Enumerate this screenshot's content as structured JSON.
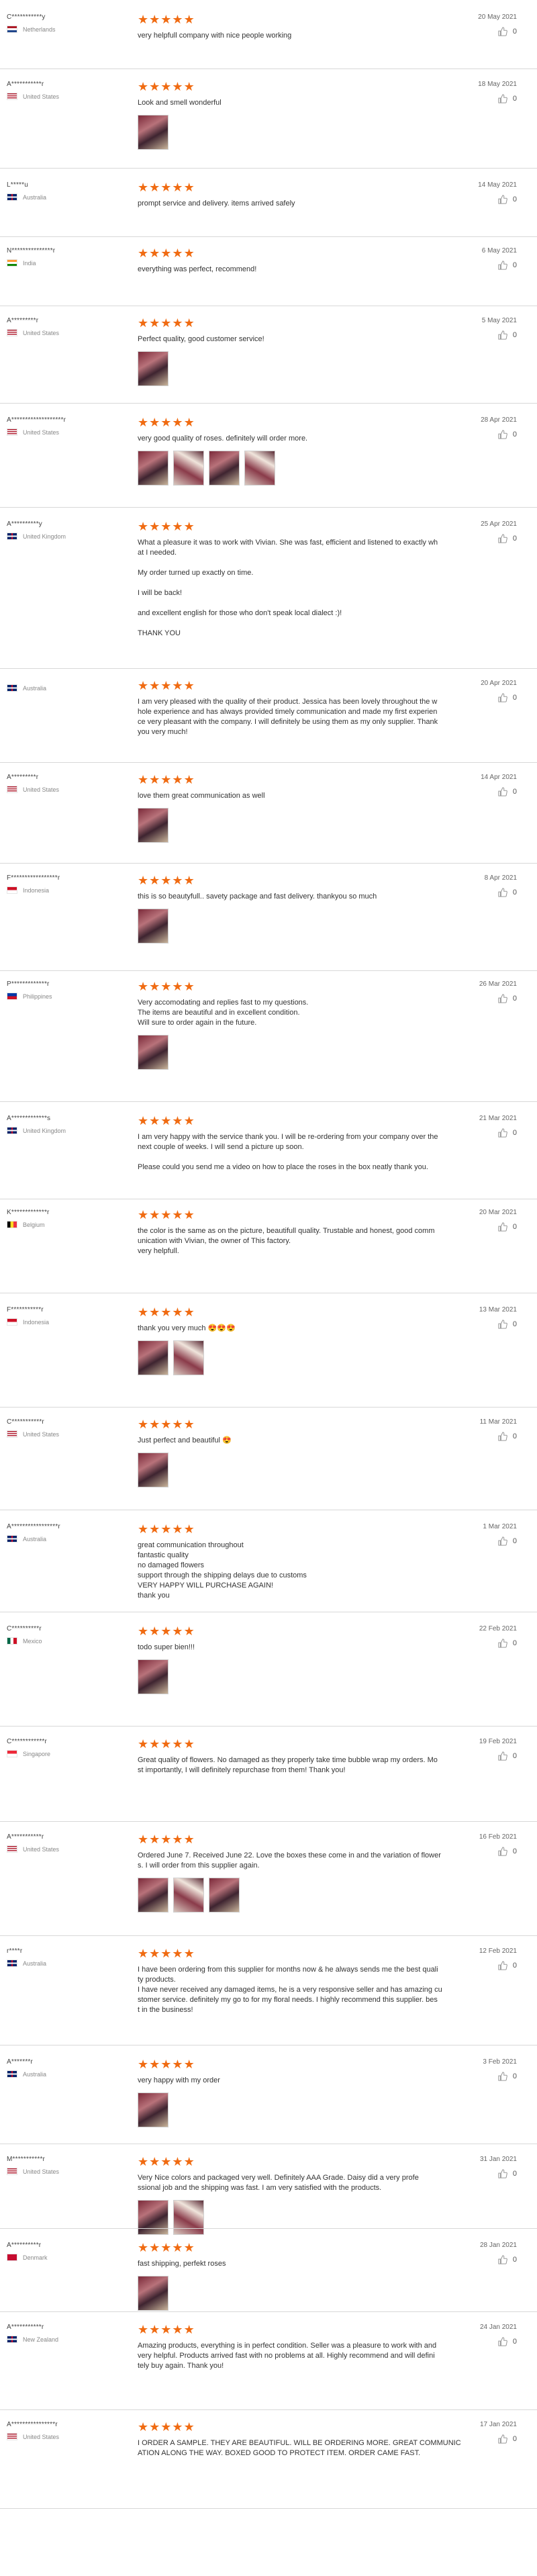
{
  "colors": {
    "star": "#f06b12",
    "divider": "#d8d8d8"
  },
  "icons": {
    "star": "star-icon",
    "useful": "thumbs-up-icon"
  },
  "reviews": [
    {
      "buyer": "C***********y",
      "country": "Netherlands",
      "flag": "nl",
      "date": "20 May 2021",
      "text": "very helpfull company with nice people working",
      "photos": 0,
      "useful": "0"
    },
    {
      "buyer": "A***********r",
      "country": "United States",
      "flag": "us",
      "date": "18 May 2021",
      "text": "Look and smell wonderful",
      "photos": 1,
      "useful": "0"
    },
    {
      "buyer": "L*****u",
      "country": "Australia",
      "flag": "au",
      "date": "14 May 2021",
      "text": "prompt service and delivery. items arrived safely",
      "photos": 0,
      "useful": "0"
    },
    {
      "buyer": "N***************r",
      "country": "India",
      "flag": "in",
      "date": "6 May 2021",
      "text": "everything was perfect, recommend!",
      "photos": 0,
      "useful": "0"
    },
    {
      "buyer": "A*********r",
      "country": "United States",
      "flag": "us",
      "date": "5 May 2021",
      "text": "Perfect quality, good customer service!",
      "photos": 1,
      "useful": "0"
    },
    {
      "buyer": "A*******************r",
      "country": "United States",
      "flag": "us",
      "date": "28 Apr 2021",
      "text": "very good quality of roses. definitely will order more.",
      "photos": 4,
      "useful": "0"
    },
    {
      "buyer": "A**********y",
      "country": "United Kingdom",
      "flag": "gb",
      "date": "25 Apr 2021",
      "text": "What a pleasure it was to work with Vivian. She was fast, efficient and listened to exactly wh\nat I needed.\n\nMy order turned up exactly on time.\n\nI will be back!\n\nand excellent english for those who don't speak local dialect :)!\n\nTHANK YOU",
      "photos": 0,
      "useful": "0"
    },
    {
      "buyer": "",
      "country": "Australia",
      "flag": "au",
      "date": "20 Apr 2021",
      "text": "I am very pleased with the quality of their product. Jessica has been lovely throughout the w\nhole experience and has always provided timely communication and made my first experien\nce very pleasant with the company. I will definitely be using them as my only supplier. Thank\nyou very much!",
      "photos": 0,
      "useful": "0"
    },
    {
      "buyer": "A*********r",
      "country": "United States",
      "flag": "us",
      "date": "14 Apr 2021",
      "text": "love them great communication as well",
      "photos": 1,
      "useful": "0"
    },
    {
      "buyer": "F*****************r",
      "country": "Indonesia",
      "flag": "id",
      "date": "8 Apr 2021",
      "text": "this is so beautyfull.. savety package and fast delivery. thankyou so much",
      "photos": 1,
      "useful": "0"
    },
    {
      "buyer": "P*************r",
      "country": "Philippines",
      "flag": "ph",
      "date": "26 Mar 2021",
      "text": "Very accomodating and replies fast to my questions.\nThe items are beautiful and in excellent condition.\nWill sure to order again in the future.",
      "photos": 1,
      "useful": "0"
    },
    {
      "buyer": "A*************s",
      "country": "United Kingdom",
      "flag": "gb",
      "date": "21 Mar 2021",
      "text": "I am very happy with the service thank you. I will be re-ordering from your company over the\nnext couple of weeks. I will send a picture up soon.\n\nPlease could you send me a video on how to place the roses in the box neatly thank you.",
      "photos": 0,
      "useful": "0"
    },
    {
      "buyer": "K*************r",
      "country": "Belgium",
      "flag": "be",
      "date": "20 Mar 2021",
      "text": "the color is the same as on the picture, beautifull quality. Trustable and honest, good comm\nunication with Vivian, the owner of This factory.\nvery helpfull.",
      "photos": 0,
      "useful": "0"
    },
    {
      "buyer": "F***********r",
      "country": "Indonesia",
      "flag": "id",
      "date": "13 Mar 2021",
      "text": "thank you very much 😍😍😍",
      "photos": 2,
      "useful": "0"
    },
    {
      "buyer": "C***********r",
      "country": "United States",
      "flag": "us",
      "date": "11 Mar 2021",
      "text": "Just perfect and beautiful 😍",
      "photos": 1,
      "useful": "0"
    },
    {
      "buyer": "A*****************r",
      "country": "Australia",
      "flag": "au",
      "date": "1 Mar 2021",
      "text": "great communication throughout\nfantastic quality\nno damaged flowers\nsupport through the shipping delays due to customs\nVERY HAPPY WILL PURCHASE AGAIN!\nthank you",
      "photos": 0,
      "useful": "0"
    },
    {
      "buyer": "C**********r",
      "country": "Mexico",
      "flag": "mx",
      "date": "22 Feb 2021",
      "text": "todo super bien!!!",
      "photos": 1,
      "useful": "0"
    },
    {
      "buyer": "C************r",
      "country": "Singapore",
      "flag": "sg",
      "date": "19 Feb 2021",
      "text": "Great quality of flowers. No damaged as they properly take time bubble wrap my orders. Mo\nst importantly, I will definitely repurchase from them! Thank you!",
      "photos": 0,
      "useful": "0"
    },
    {
      "buyer": "A***********r",
      "country": "United States",
      "flag": "us",
      "date": "16 Feb 2021",
      "text": "Ordered June 7. Received June 22. Love the boxes these come in and the variation of flower\ns. I will order from this supplier again.",
      "photos": 3,
      "useful": "0"
    },
    {
      "buyer": "r****r",
      "country": "Australia",
      "flag": "au",
      "date": "12 Feb 2021",
      "text": "I have been ordering from this supplier for months now & he always sends me the best quali\nty products.\nI have never received any damaged items, he is a very responsive seller and has amazing cu\nstomer service. definitely my go to for my floral needs. I highly recommend this supplier. bes\nt in the business!",
      "photos": 0,
      "useful": "0"
    },
    {
      "buyer": "A*******r",
      "country": "Australia",
      "flag": "au",
      "date": "3 Feb 2021",
      "text": "very happy with my order",
      "photos": 1,
      "useful": "0"
    },
    {
      "buyer": "M***********r",
      "country": "United States",
      "flag": "us",
      "date": "31 Jan 2021",
      "text": "Very Nice colors and packaged very well. Definitely AAA Grade. Daisy did a very profe\nssional job and the shipping was fast. I am very satisfied with the products.",
      "photos": 2,
      "useful": "0"
    },
    {
      "buyer": "A**********r",
      "country": "Denmark",
      "flag": "dk",
      "date": "28 Jan 2021",
      "text": "fast shipping, perfekt roses",
      "photos": 1,
      "useful": "0"
    },
    {
      "buyer": "A***********r",
      "country": "New Zealand",
      "flag": "nz",
      "date": "24 Jan 2021",
      "text": "Amazing products, everything is in perfect condition. Seller was a pleasure to work with and\nvery helpful. Products arrived fast with no problems at all. Highly recommend and will defini\ntely buy again. Thank you!",
      "photos": 0,
      "useful": "0"
    },
    {
      "buyer": "A****************r",
      "country": "United States",
      "flag": "us",
      "date": "17 Jan 2021",
      "text": "I ORDER A SAMPLE. THEY ARE BEAUTIFUL. WILL BE ORDERING MORE. GREAT COMMUNIC\nATION ALONG THE WAY. BOXED GOOD TO PROTECT ITEM. ORDER CAME FAST.",
      "photos": 0,
      "useful": "0"
    }
  ]
}
